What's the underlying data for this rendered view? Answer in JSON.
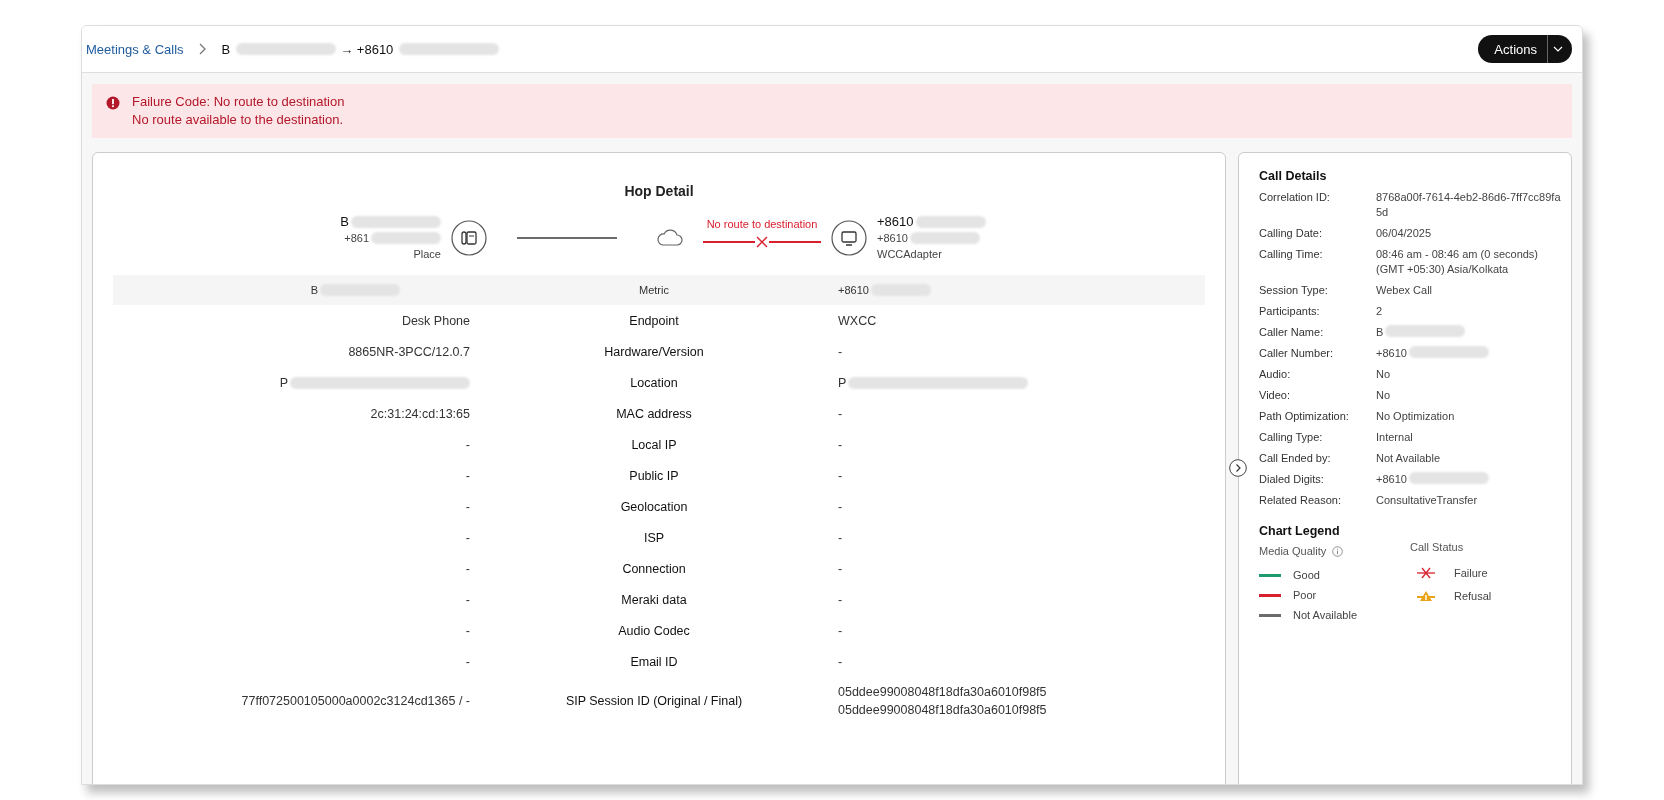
{
  "breadcrumb": [
    {
      "text": "Meetings & Calls",
      "kind": "link"
    },
    {
      "text": "B",
      "kind": "redacted"
    },
    {
      "text": "→ +8610",
      "kind": "redacted"
    }
  ],
  "actions_button": {
    "label": "Actions"
  },
  "alert": {
    "title": "Failure Code:  No route to destination",
    "message": "No route available to the destination."
  },
  "hop_detail": {
    "title": "Hop Detail",
    "source": {
      "name": "B",
      "number": "+861",
      "type": "Place"
    },
    "link_left": {
      "failed": false
    },
    "link_right": {
      "failed": true,
      "label": "No route to destination"
    },
    "destination": {
      "name": "+8610",
      "number": "+8610",
      "type": "WCCAdapter"
    },
    "table": {
      "columns": [
        "B",
        "Metric",
        "+8610"
      ],
      "rows": [
        {
          "left": "Desk Phone",
          "metric": "Endpoint",
          "right": "WXCC"
        },
        {
          "left": "8865NR-3PCC/12.0.7",
          "metric": "Hardware/Version",
          "right": "-"
        },
        {
          "left": "P",
          "metric": "Location",
          "right": "P",
          "redacted": true
        },
        {
          "left": "2c:31:24:cd:13:65",
          "metric": "MAC address",
          "right": "-"
        },
        {
          "left": "-",
          "metric": "Local IP",
          "right": "-"
        },
        {
          "left": "-",
          "metric": "Public IP",
          "right": "-"
        },
        {
          "left": "-",
          "metric": "Geolocation",
          "right": "-"
        },
        {
          "left": "-",
          "metric": "ISP",
          "right": "-"
        },
        {
          "left": "-",
          "metric": "Connection",
          "right": "-"
        },
        {
          "left": "-",
          "metric": "Meraki data",
          "right": "-"
        },
        {
          "left": "-",
          "metric": "Audio Codec",
          "right": "-"
        },
        {
          "left": "-",
          "metric": "Email ID",
          "right": "-"
        },
        {
          "left": "77ff072500105000a0002c3124cd1365 / -",
          "metric": "SIP Session ID (Original / Final)",
          "right": "05ddee99008048f18dfa30a6010f98f5\n05ddee99008048f18dfa30a6010f98f5"
        }
      ]
    }
  },
  "call_details": {
    "title": "Call Details",
    "items": [
      {
        "label": "Correlation ID:",
        "value": "8768a00f-7614-4eb2-86d6-7ff7cc89fa5d"
      },
      {
        "label": "Calling Date:",
        "value": "06/04/2025"
      },
      {
        "label": "Calling Time:",
        "value": "08:46 am - 08:46 am (0 seconds)\n(GMT +05:30) Asia/Kolkata"
      },
      {
        "label": "Session Type:",
        "value": "Webex Call"
      },
      {
        "label": "Participants:",
        "value": "2"
      },
      {
        "label": "Caller Name:",
        "value": "B",
        "redacted": true
      },
      {
        "label": "Caller Number:",
        "value": "+8610",
        "redacted": true
      },
      {
        "label": "Audio:",
        "value": "No"
      },
      {
        "label": "Video:",
        "value": "No"
      },
      {
        "label": "Path Optimization:",
        "value": "No Optimization"
      },
      {
        "label": "Calling Type:",
        "value": "Internal"
      },
      {
        "label": "Call Ended by:",
        "value": "Not Available"
      },
      {
        "label": "Dialed Digits:",
        "value": "+8610",
        "redacted": true
      },
      {
        "label": "Related Reason:",
        "value": "ConsultativeTransfer"
      }
    ]
  },
  "chart_legend": {
    "title": "Chart Legend",
    "media_quality": {
      "title": "Media Quality",
      "items": [
        {
          "label": "Good",
          "color": "#1d9b6c"
        },
        {
          "label": "Poor",
          "color": "#d9202e"
        },
        {
          "label": "Not Available",
          "color": "#6b6b6b"
        }
      ]
    },
    "call_status": {
      "title": "Call Status",
      "items": [
        {
          "label": "Failure",
          "kind": "failure"
        },
        {
          "label": "Refusal",
          "kind": "refusal"
        }
      ]
    }
  }
}
